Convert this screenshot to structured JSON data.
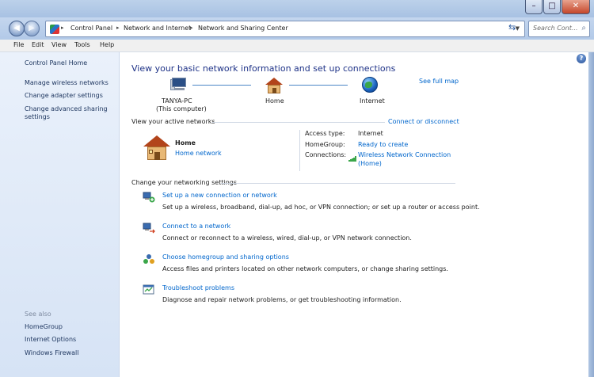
{
  "address": {
    "crumbs": [
      "Control Panel",
      "Network and Internet",
      "Network and Sharing Center"
    ],
    "search_placeholder": "Search Cont..."
  },
  "menu": [
    "File",
    "Edit",
    "View",
    "Tools",
    "Help"
  ],
  "left": {
    "home": "Control Panel Home",
    "links": [
      "Manage wireless networks",
      "Change adapter settings",
      "Change advanced sharing",
      "settings"
    ],
    "see_also_title": "See also",
    "see_also": [
      "HomeGroup",
      "Internet Options",
      "Windows Firewall"
    ]
  },
  "main": {
    "title": "View your basic network information and set up connections",
    "see_full_map": "See full map",
    "map": {
      "computer_name": "TANYA-PC",
      "computer_sub": "(This computer)",
      "network": "Home",
      "internet": "Internet"
    },
    "active_header": "View your active networks",
    "connect_disconnect": "Connect or disconnect",
    "active": {
      "name": "Home",
      "type": "Home network",
      "access_type_label": "Access type:",
      "access_type": "Internet",
      "homegroup_label": "HomeGroup:",
      "homegroup": "Ready to create",
      "connections_label": "Connections:",
      "connection_1": "Wireless Network Connection",
      "connection_2": "(Home)"
    },
    "settings_header": "Change your networking settings",
    "tasks": [
      {
        "link": "Set up a new connection or network",
        "desc": "Set up a wireless, broadband, dial-up, ad hoc, or VPN connection; or set up a router or access point.",
        "icon": "new-connection-icon"
      },
      {
        "link": "Connect to a network",
        "desc": "Connect or reconnect to a wireless, wired, dial-up, or VPN network connection.",
        "icon": "connect-network-icon"
      },
      {
        "link": "Choose homegroup and sharing options",
        "desc": "Access files and printers located on other network computers, or change sharing settings.",
        "icon": "homegroup-icon"
      },
      {
        "link": "Troubleshoot problems",
        "desc": "Diagnose and repair network problems, or get troubleshooting information.",
        "icon": "troubleshoot-icon"
      }
    ]
  },
  "colors": {
    "link": "#0066cc",
    "title": "#1e3287"
  }
}
